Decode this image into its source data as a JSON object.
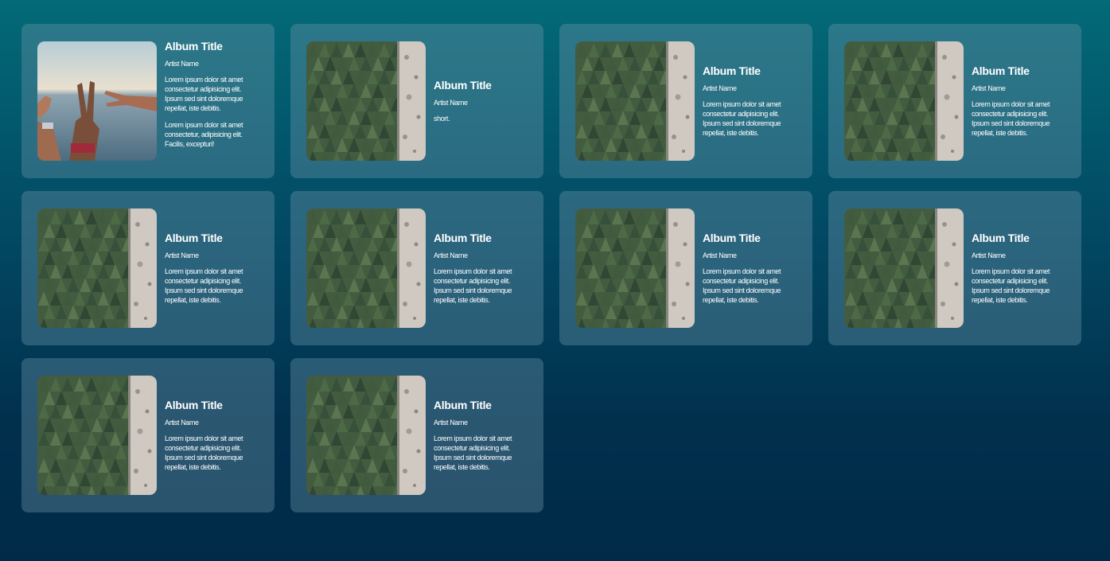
{
  "albums": [
    {
      "image": "peace-hands-photo",
      "title": "Album Title",
      "artist": "Artist Name",
      "description": [
        "Lorem ipsum dolor sit amet consectetur adipisicing elit. Ipsum sed sint doloremque repellat, iste debitis.",
        "Lorem ipsum dolor sit amet consectetur, adipisicing elit. Facilis, excepturi!"
      ]
    },
    {
      "image": "forest-photo",
      "title": "Album Title",
      "artist": "Artist Name",
      "description": [
        "short."
      ]
    },
    {
      "image": "forest-photo",
      "title": "Album Title",
      "artist": "Artist Name",
      "description": [
        "Lorem ipsum dolor sit amet consectetur adipisicing elit. Ipsum sed sint doloremque repellat, iste debitis."
      ]
    },
    {
      "image": "forest-photo",
      "title": "Album Title",
      "artist": "Artist Name",
      "description": [
        "Lorem ipsum dolor sit amet consectetur adipisicing elit. Ipsum sed sint doloremque repellat, iste debitis."
      ]
    },
    {
      "image": "forest-photo",
      "title": "Album Title",
      "artist": "Artist Name",
      "description": [
        "Lorem ipsum dolor sit amet consectetur adipisicing elit. Ipsum sed sint doloremque repellat, iste debitis."
      ]
    },
    {
      "image": "forest-photo",
      "title": "Album Title",
      "artist": "Artist Name",
      "description": [
        "Lorem ipsum dolor sit amet consectetur adipisicing elit. Ipsum sed sint doloremque repellat, iste debitis."
      ]
    },
    {
      "image": "forest-photo",
      "title": "Album Title",
      "artist": "Artist Name",
      "description": [
        "Lorem ipsum dolor sit amet consectetur adipisicing elit. Ipsum sed sint doloremque repellat, iste debitis."
      ]
    },
    {
      "image": "forest-photo",
      "title": "Album Title",
      "artist": "Artist Name",
      "description": [
        "Lorem ipsum dolor sit amet consectetur adipisicing elit. Ipsum sed sint doloremque repellat, iste debitis."
      ]
    },
    {
      "image": "forest-photo",
      "title": "Album Title",
      "artist": "Artist Name",
      "description": [
        "Lorem ipsum dolor sit amet consectetur adipisicing elit. Ipsum sed sint doloremque repellat, iste debitis."
      ]
    },
    {
      "image": "forest-photo",
      "title": "Album Title",
      "artist": "Artist Name",
      "description": [
        "Lorem ipsum dolor sit amet consectetur adipisicing elit. Ipsum sed sint doloremque repellat, iste debitis."
      ]
    }
  ]
}
